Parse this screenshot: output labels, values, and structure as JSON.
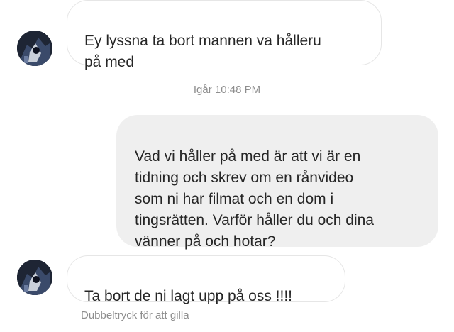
{
  "messages": [
    {
      "from": "other",
      "text": "Ey lyssna ta bort mannen va hålleru\npå med"
    },
    {
      "from": "me",
      "text": "Vad vi håller på med är att vi är en\ntidning och skrev om en rånvideo\nsom ni har filmat och en dom i\ntingsrätten. Varför håller du och dina\nvänner på och hotar?"
    },
    {
      "from": "other",
      "text": "Ta bort de ni lagt upp på oss !!!!"
    }
  ],
  "timestamp": "Igår 10:48 PM",
  "hint": "Dubbeltryck för att gilla",
  "colors": {
    "received_bubble": "#ffffff",
    "sent_bubble": "#efefef",
    "meta_text": "#8e8e8e"
  },
  "icons": {
    "avatar": "user-avatar-photo"
  }
}
